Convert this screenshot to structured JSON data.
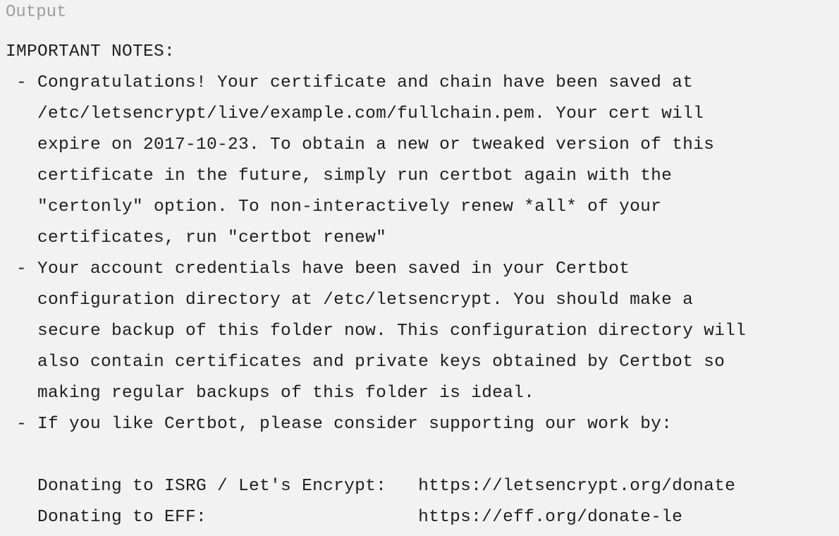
{
  "panel": {
    "label": "Output",
    "lines": [
      "IMPORTANT NOTES:",
      " - Congratulations! Your certificate and chain have been saved at",
      "   /etc/letsencrypt/live/example.com/fullchain.pem. Your cert will",
      "   expire on 2017-10-23. To obtain a new or tweaked version of this",
      "   certificate in the future, simply run certbot again with the",
      "   \"certonly\" option. To non-interactively renew *all* of your",
      "   certificates, run \"certbot renew\"",
      " - Your account credentials have been saved in your Certbot",
      "   configuration directory at /etc/letsencrypt. You should make a",
      "   secure backup of this folder now. This configuration directory will",
      "   also contain certificates and private keys obtained by Certbot so",
      "   making regular backups of this folder is ideal.",
      " - If you like Certbot, please consider supporting our work by:",
      "",
      "   Donating to ISRG / Let's Encrypt:   https://letsencrypt.org/donate",
      "   Donating to EFF:                    https://eff.org/donate-le"
    ]
  }
}
